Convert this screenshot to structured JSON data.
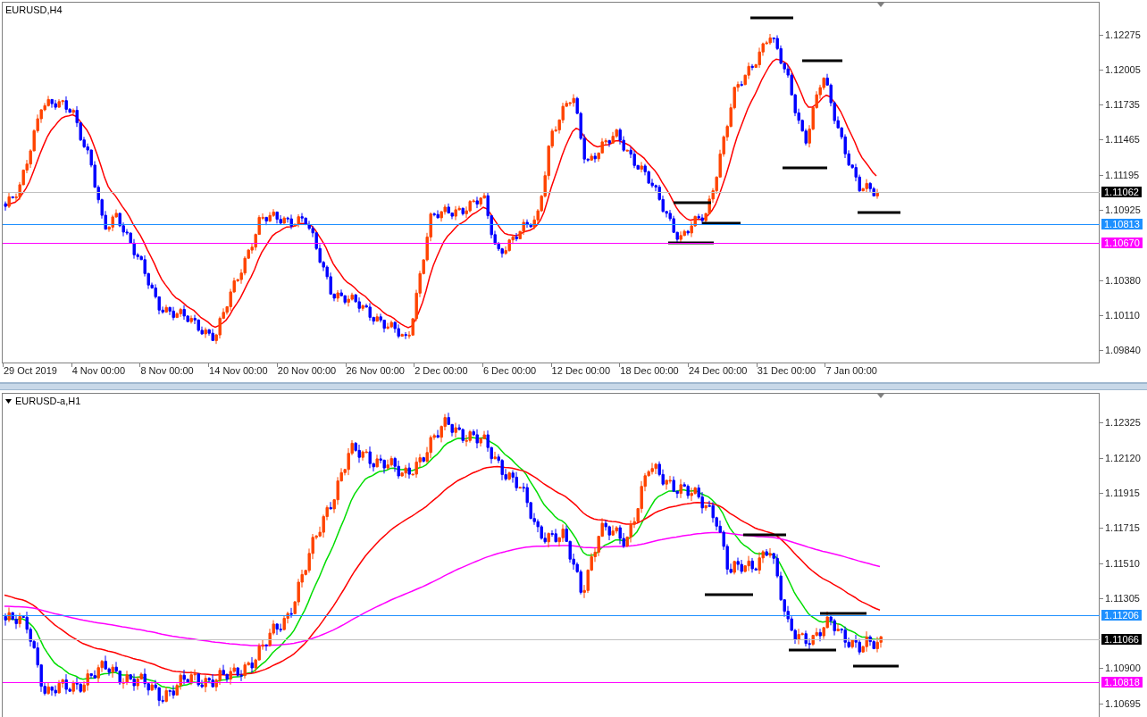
{
  "panes": [
    {
      "title": "EURUSD,H4",
      "menu_icon": false,
      "price_ticks": [
        "1.12275",
        "1.12005",
        "1.11735",
        "1.11465",
        "1.11195",
        "1.10925",
        "1.10380",
        "1.10110",
        "1.09840"
      ],
      "price_lines": [
        {
          "kind": "bid",
          "price": "1.11062",
          "color": "#c0c0c0"
        },
        {
          "kind": "level",
          "price": "1.10813",
          "color": "#1e90ff"
        },
        {
          "kind": "level",
          "price": "1.10670",
          "color": "#ff00ff"
        }
      ],
      "time_labels": [
        "29 Oct 2019",
        "4 Nov 00:00",
        "8 Nov 00:00",
        "14 Nov 00:00",
        "20 Nov 00:00",
        "26 Nov 00:00",
        "2 Dec 00:00",
        "6 Dec 00:00",
        "12 Dec 00:00",
        "18 Dec 00:00",
        "24 Dec 00:00",
        "31 Dec 00:00",
        "7 Jan 00:00"
      ]
    },
    {
      "title": "EURUSD-a,H1",
      "menu_icon": true,
      "price_ticks": [
        "1.12325",
        "1.12120",
        "1.11915",
        "1.11715",
        "1.11510",
        "1.11305",
        "1.10900",
        "1.10695"
      ],
      "price_lines": [
        {
          "kind": "level",
          "price": "1.11206",
          "color": "#1e90ff"
        },
        {
          "kind": "bid",
          "price": "1.11066",
          "color": "#c0c0c0"
        },
        {
          "kind": "level",
          "price": "1.10818",
          "color": "#ff00ff"
        }
      ]
    }
  ]
}
